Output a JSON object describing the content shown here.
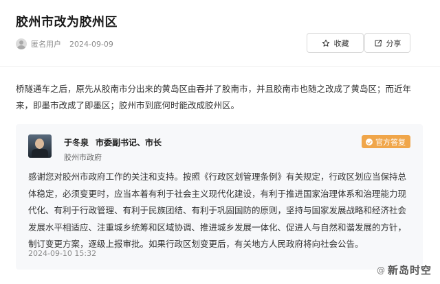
{
  "article": {
    "title": "胶州市改为胶州区",
    "author": "匿名用户",
    "date": "2024-09-09"
  },
  "actions": {
    "favorite_label": "收藏",
    "share_label": "分享"
  },
  "question": {
    "text": "桥隧通车之后，原先从胶南市分出来的黄岛区由吞并了胶南市，并且胶南市也随之改成了黄岛区；而近年来，即墨市改成了即墨区；胶州市到底何时能改成胶州区。"
  },
  "answer": {
    "name": "于冬泉",
    "role": "市委副书记、市长",
    "org": "胶州市政府",
    "badge": "官方答复",
    "text": "感谢您对胶州市政府工作的关注和支持。按照《行政区划管理条例》有关规定，行政区划应当保持总体稳定，必须变更时，应当本着有利于社会主义现代化建设，有利于推进国家治理体系和治理能力现代化、有利于行政管理、有利于民族团结、有利于巩固国防的原则，坚持与国家发展战略和经济社会发展水平相适应、注重城乡统筹和区域协调、推进城乡发展一体化、促进人与自然和谐发展的方针，制订变更方案，逐级上报审批。如果行政区划变更后，有关地方人民政府将向社会公告。",
    "time": "2024-09-10 15:32"
  },
  "watermark": {
    "text": "新岛时空",
    "prefix": "@"
  },
  "icons": {
    "favorite": "star-icon",
    "share": "share-icon",
    "badge": "check-circle-icon",
    "avatar": "user-avatar-icon"
  },
  "colors": {
    "badge": "#f0a64a",
    "card_background": "#f7f8fa"
  }
}
